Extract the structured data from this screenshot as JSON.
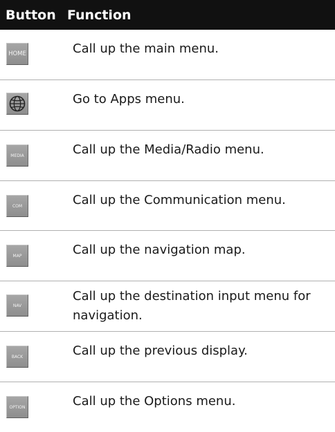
{
  "header": {
    "col_button": "Button",
    "col_function": "Function"
  },
  "rows": [
    {
      "icon": "home-button-icon",
      "button_text": "HOME",
      "function": "Call up the main menu."
    },
    {
      "icon": "globe-icon",
      "button_text": "",
      "function": "Go to Apps menu."
    },
    {
      "icon": "media-button-icon",
      "button_text": "MEDIA",
      "function": "Call up the Media/Radio menu."
    },
    {
      "icon": "com-button-icon",
      "button_text": "COM",
      "function": "Call up the Communication menu."
    },
    {
      "icon": "map-button-icon",
      "button_text": "MAP",
      "function": "Call up the navigation map."
    },
    {
      "icon": "nav-button-icon",
      "button_text": "NAV",
      "function": "Call up the destination input menu for navigation."
    },
    {
      "icon": "back-button-icon",
      "button_text": "BACK",
      "function": "Call up the previous display."
    },
    {
      "icon": "option-button-icon",
      "button_text": "OPTION",
      "function": "Call up the Options menu."
    }
  ]
}
